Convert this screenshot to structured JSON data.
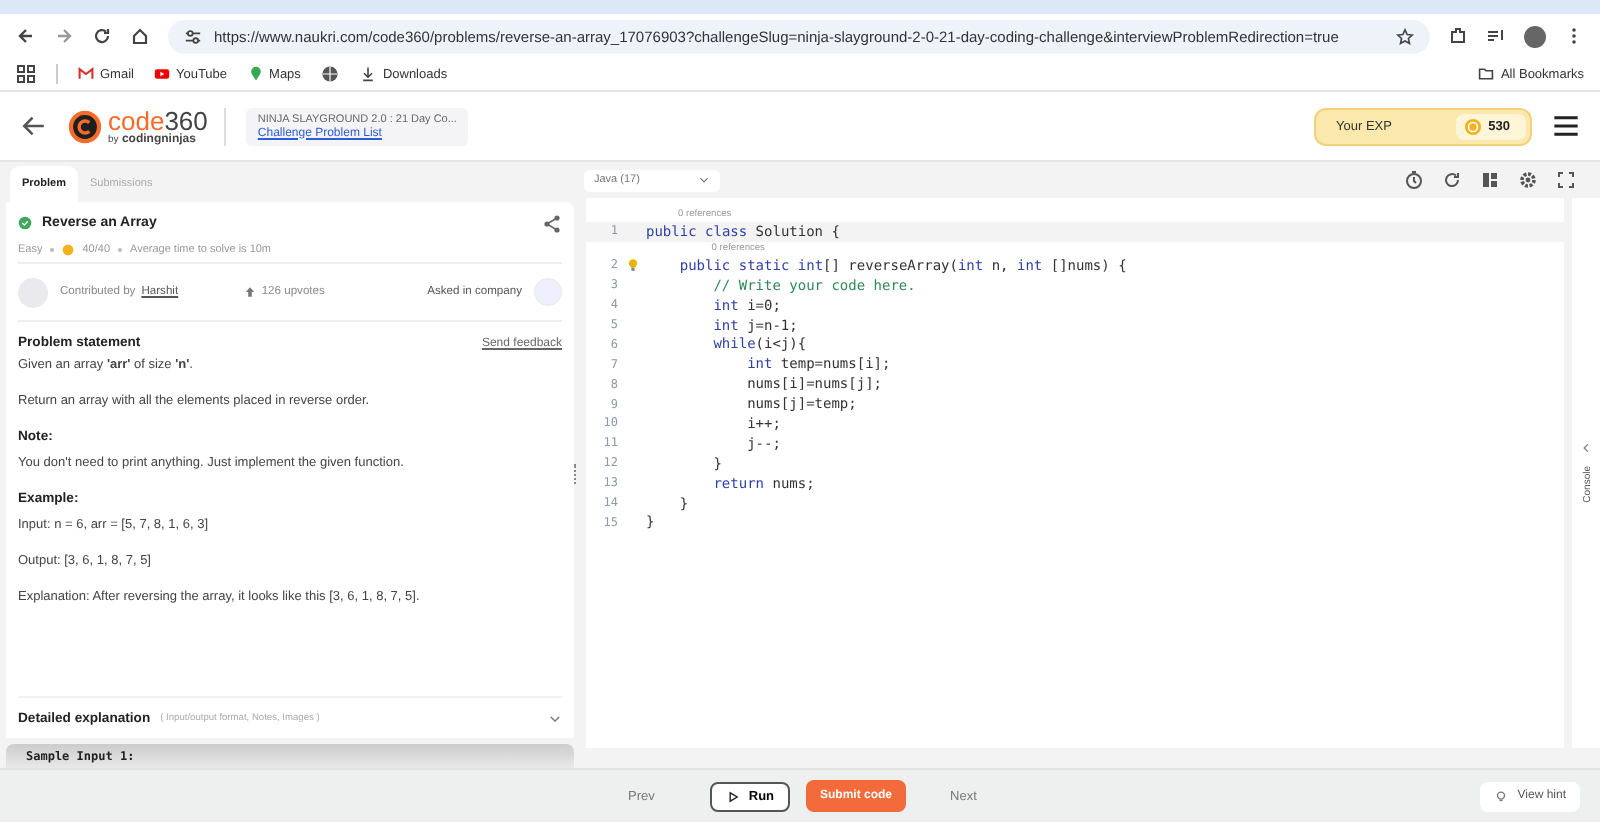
{
  "browser": {
    "url": "https://www.naukri.com/code360/problems/reverse-an-array_17076903?challengeSlug=ninja-slayground-2-0-21-day-coding-challenge&interviewProblemRedirection=true",
    "bookmarks": [
      {
        "label": "Gmail",
        "kind": "gmail"
      },
      {
        "label": "YouTube",
        "kind": "youtube"
      },
      {
        "label": "Maps",
        "kind": "maps"
      },
      {
        "kind": "globe"
      },
      {
        "label": "Downloads",
        "kind": "download"
      }
    ],
    "all_bookmarks": "All Bookmarks"
  },
  "header": {
    "logo_main": "code",
    "logo_num": "360",
    "logo_sub_prefix": "by",
    "logo_sub": "codingninjas",
    "challenge_title": "NINJA SLAYGROUND 2.0 : 21 Day Co...",
    "challenge_link": "Challenge Problem List",
    "exp_label": "Your EXP",
    "exp_value": "530"
  },
  "tabs": [
    {
      "label": "Problem",
      "selected": true
    },
    {
      "label": "Submissions",
      "selected": false
    }
  ],
  "problem": {
    "title": "Reverse an Array",
    "solved": true,
    "difficulty": "Easy",
    "score": "40/40",
    "avg_time": "Average time to solve is 10m",
    "contributed_prefix": "Contributed by",
    "contributor": "Harshit",
    "upvotes": "126 upvotes",
    "asked_in": "Asked in company",
    "statement_heading": "Problem statement",
    "feedback": "Send feedback",
    "paragraphs": [
      {
        "kind": "text",
        "text": "Given an array **'arr'** of size **'n'**."
      },
      {
        "kind": "text",
        "text": "Return an array with all the elements placed in reverse order."
      },
      {
        "kind": "heading",
        "text": "Note:"
      },
      {
        "kind": "text",
        "text": "You don't need to print anything. Just implement the given function."
      },
      {
        "kind": "heading",
        "text": "Example:"
      },
      {
        "kind": "text",
        "text": "Input: n = 6, arr = [5, 7, 8, 1, 6, 3]"
      },
      {
        "kind": "text",
        "text": "Output: [3, 6, 1, 8, 7, 5]"
      },
      {
        "kind": "text",
        "text": "Explanation: After reversing the array, it looks like this [3, 6, 1, 8, 7, 5]."
      }
    ],
    "detailed_label": "Detailed explanation",
    "detailed_hint": "( Input/output format, Notes, Images )",
    "expanded": false,
    "sample_label": "Sample Input 1:"
  },
  "editor": {
    "language": "Java (17)",
    "lines": [
      {
        "number": "1",
        "lens": "0 references",
        "current": true,
        "bulb": false,
        "segments": [
          {
            "kind": "keyword",
            "text": "public"
          },
          {
            "kind": "keyword",
            "text": " class"
          },
          {
            "kind": "plain",
            "text": " Solution {"
          }
        ]
      },
      {
        "number": "2",
        "lens": "0 references",
        "current": false,
        "bulb": true,
        "segments": [
          {
            "kind": "keyword",
            "text": "    public"
          },
          {
            "kind": "keyword",
            "text": " static"
          },
          {
            "kind": "keyword",
            "text": " int"
          },
          {
            "kind": "plain",
            "text": "[] reverseArray("
          },
          {
            "kind": "keyword",
            "text": "int"
          },
          {
            "kind": "plain",
            "text": " n, "
          },
          {
            "kind": "keyword",
            "text": "int"
          },
          {
            "kind": "plain",
            "text": " []nums) {"
          }
        ]
      },
      {
        "number": "3",
        "current": false,
        "bulb": false,
        "segments": [
          {
            "kind": "comment",
            "text": "        // Write your code here."
          }
        ]
      },
      {
        "number": "4",
        "current": false,
        "bulb": false,
        "segments": [
          {
            "kind": "keyword",
            "text": "        int"
          },
          {
            "kind": "plain",
            "text": " i=0;"
          }
        ]
      },
      {
        "number": "5",
        "current": false,
        "bulb": false,
        "segments": [
          {
            "kind": "keyword",
            "text": "        int"
          },
          {
            "kind": "plain",
            "text": " j=n-1;"
          }
        ]
      },
      {
        "number": "6",
        "current": false,
        "bulb": false,
        "segments": [
          {
            "kind": "keyword",
            "text": "        while"
          },
          {
            "kind": "plain",
            "text": "(i<j){"
          }
        ]
      },
      {
        "number": "7",
        "current": false,
        "bulb": false,
        "segments": [
          {
            "kind": "keyword",
            "text": "            int"
          },
          {
            "kind": "plain",
            "text": " temp=nums[i];"
          }
        ]
      },
      {
        "number": "8",
        "current": false,
        "bulb": false,
        "segments": [
          {
            "kind": "plain",
            "text": "            nums[i]=nums[j];"
          }
        ]
      },
      {
        "number": "9",
        "current": false,
        "bulb": false,
        "segments": [
          {
            "kind": "plain",
            "text": "            nums[j]=temp;"
          }
        ]
      },
      {
        "number": "10",
        "current": false,
        "bulb": false,
        "segments": [
          {
            "kind": "plain",
            "text": "            i++;"
          }
        ]
      },
      {
        "number": "11",
        "current": false,
        "bulb": false,
        "segments": [
          {
            "kind": "plain",
            "text": "            j--;"
          }
        ]
      },
      {
        "number": "12",
        "current": false,
        "bulb": false,
        "segments": [
          {
            "kind": "plain",
            "text": "        }"
          }
        ]
      },
      {
        "number": "13",
        "current": false,
        "bulb": false,
        "segments": [
          {
            "kind": "keyword",
            "text": "        return"
          },
          {
            "kind": "plain",
            "text": " nums;"
          }
        ]
      },
      {
        "number": "14",
        "current": false,
        "bulb": false,
        "segments": [
          {
            "kind": "plain",
            "text": "    }"
          }
        ]
      },
      {
        "number": "15",
        "current": false,
        "bulb": false,
        "segments": [
          {
            "kind": "plain",
            "text": "}"
          }
        ]
      }
    ],
    "console_label": "Console"
  },
  "footer": {
    "prev": "Prev",
    "run": "Run",
    "submit": "Submit code",
    "next": "Next",
    "hint": "View hint"
  }
}
